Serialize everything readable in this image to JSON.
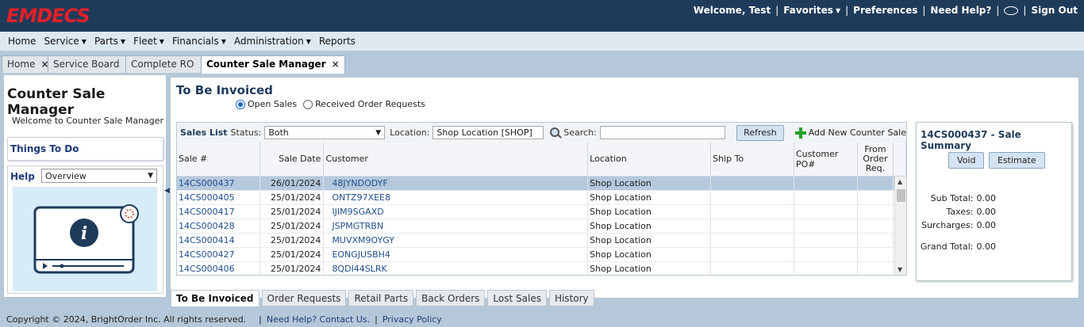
{
  "app": {
    "logo": "EMDECS"
  },
  "topnav": {
    "welcome": "Welcome, Test",
    "favorites": "Favorites",
    "preferences": "Preferences",
    "need_help": "Need Help?",
    "sign_out": "Sign Out"
  },
  "menu": [
    "Home",
    "Service",
    "Parts",
    "Fleet",
    "Financials",
    "Administration",
    "Reports"
  ],
  "tabs": [
    {
      "label": "Home"
    },
    {
      "label": "Service Board"
    },
    {
      "label": "Complete RO"
    },
    {
      "label": "Counter Sale Manager",
      "active": true
    }
  ],
  "left": {
    "title": "Counter Sale Manager",
    "welcome": "Welcome to Counter Sale Manager",
    "things_to_do": "Things To Do",
    "help_label": "Help",
    "help_select": "Overview"
  },
  "center": {
    "title": "To Be Invoiced",
    "radio_open": "Open Sales",
    "radio_received": "Received Order Requests",
    "list_title": "Sales List",
    "status_label": "Status:",
    "status_value": "Both",
    "location_label": "Location:",
    "location_value": "Shop Location [SHOP]",
    "search_label": "Search:",
    "search_value": "",
    "refresh": "Refresh",
    "add_new": "Add New Counter Sale",
    "columns": [
      "Sale #",
      "Sale Date",
      "Customer",
      "Location",
      "Ship To",
      "Customer PO#",
      "From Order Req."
    ],
    "rows": [
      {
        "sale": "14CS000437",
        "date": "26/01/2024",
        "customer": "48JYNDODYF",
        "location": "Shop Location",
        "selected": true
      },
      {
        "sale": "14CS000405",
        "date": "25/01/2024",
        "customer": "ONTZ97XEE8",
        "location": "Shop Location"
      },
      {
        "sale": "14CS000417",
        "date": "25/01/2024",
        "customer": "IJIM9SGAXD",
        "location": "Shop Location"
      },
      {
        "sale": "14CS000428",
        "date": "25/01/2024",
        "customer": "JSPMGTRBN",
        "location": "Shop Location"
      },
      {
        "sale": "14CS000414",
        "date": "25/01/2024",
        "customer": "MUVXM9OYGY",
        "location": "Shop Location"
      },
      {
        "sale": "14CS000427",
        "date": "25/01/2024",
        "customer": "EONGJUSBH4",
        "location": "Shop Location"
      },
      {
        "sale": "14CS000406",
        "date": "25/01/2024",
        "customer": "8QDI44SLRK",
        "location": "Shop Location"
      }
    ],
    "bottom_tabs": [
      {
        "label": "To Be Invoiced",
        "active": true
      },
      {
        "label": "Order Requests"
      },
      {
        "label": "Retail Parts"
      },
      {
        "label": "Back Orders"
      },
      {
        "label": "Lost Sales"
      },
      {
        "label": "History"
      }
    ]
  },
  "summary": {
    "title": "14CS000437 - Sale Summary",
    "void": "Void",
    "estimate": "Estimate",
    "sub_total_label": "Sub Total:",
    "sub_total": "0.00",
    "taxes_label": "Taxes:",
    "taxes": "0.00",
    "surcharges_label": "Surcharges:",
    "surcharges": "0.00",
    "grand_total_label": "Grand Total:",
    "grand_total": "0.00"
  },
  "footer": {
    "copyright": "Copyright © 2024, BrightOrder Inc. All rights reserved.",
    "help_link": "Need Help? Contact Us.",
    "privacy_link": "Privacy Policy"
  },
  "colors": {
    "topbar": "#1f3b5a",
    "logo": "#e2212b",
    "accent": "#1f3b7a",
    "selected_row": "#b5c8dd"
  }
}
